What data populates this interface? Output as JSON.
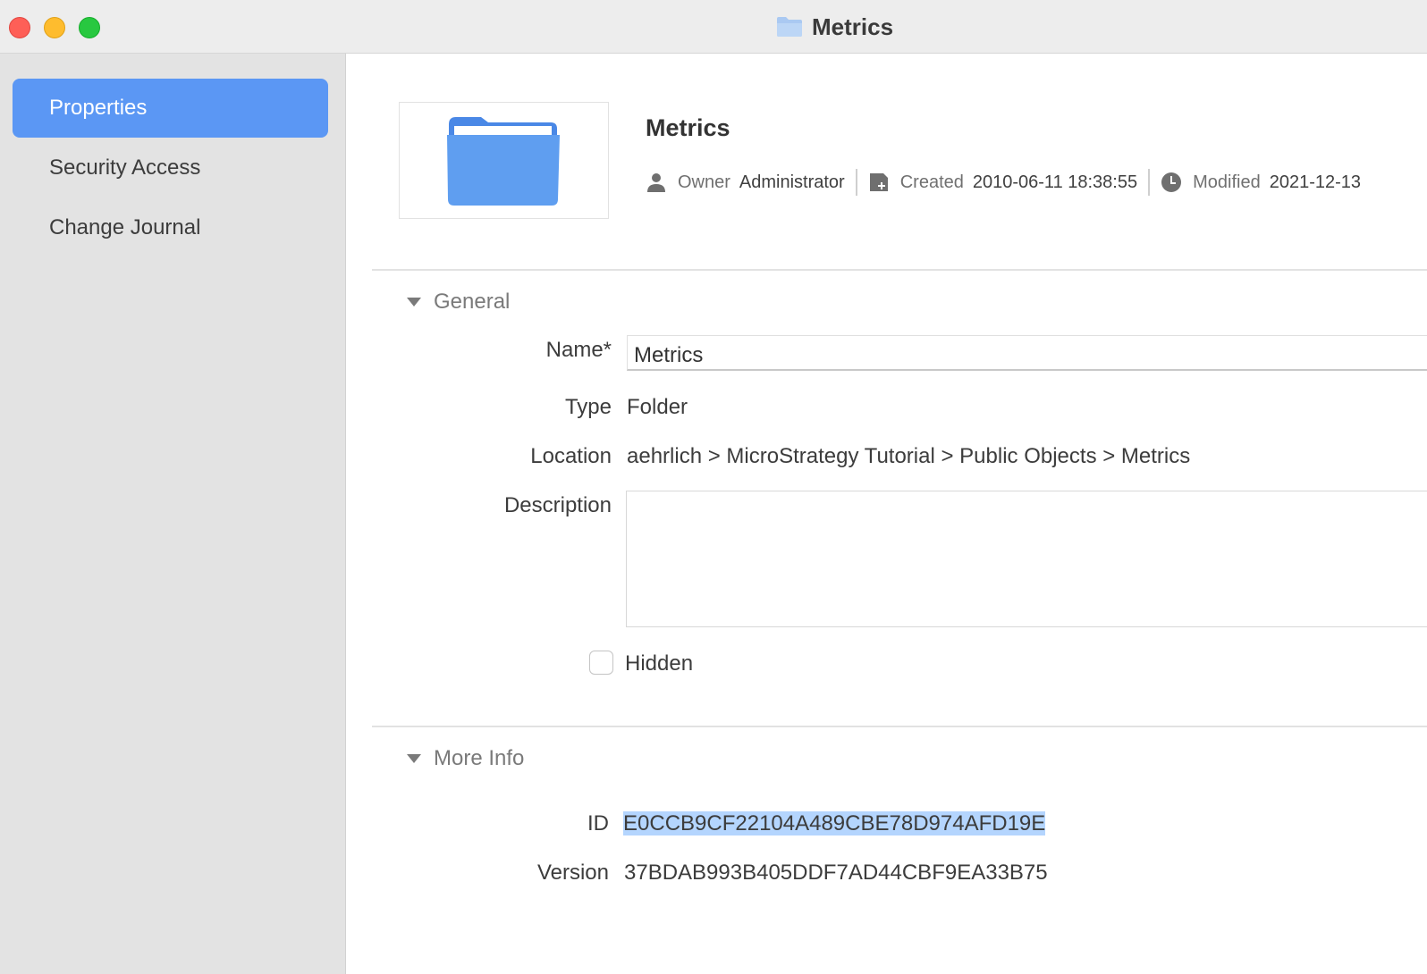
{
  "window": {
    "title": "Metrics",
    "controls": [
      "close",
      "minimize",
      "zoom"
    ]
  },
  "sidebar": {
    "items": [
      {
        "label": "Properties",
        "active": true
      },
      {
        "label": "Security Access",
        "active": false
      },
      {
        "label": "Change Journal",
        "active": false
      }
    ]
  },
  "header": {
    "object_name": "Metrics",
    "icon": "folder-icon",
    "owner_label": "Owner",
    "owner_value": "Administrator",
    "created_label": "Created",
    "created_value": "2010-06-11 18:38:55",
    "modified_label": "Modified",
    "modified_value": "2021-12-13"
  },
  "general": {
    "section_label": "General",
    "name_label": "Name*",
    "name_value": "Metrics",
    "type_label": "Type",
    "type_value": "Folder",
    "location_label": "Location",
    "location_value": "aehrlich > MicroStrategy Tutorial > Public Objects > Metrics",
    "description_label": "Description",
    "description_value": "",
    "hidden_label": "Hidden",
    "hidden_checked": false
  },
  "more_info": {
    "section_label": "More Info",
    "id_label": "ID",
    "id_value": "E0CCB9CF22104A489CBE78D974AFD19E",
    "version_label": "Version",
    "version_value": "37BDAB993B405DDF7AD44CBF9EA33B75"
  },
  "colors": {
    "accent": "#5b97f4",
    "folder": "#5f9ef0",
    "selection": "#b4d5fe",
    "sidebar_bg": "#e3e3e3"
  }
}
